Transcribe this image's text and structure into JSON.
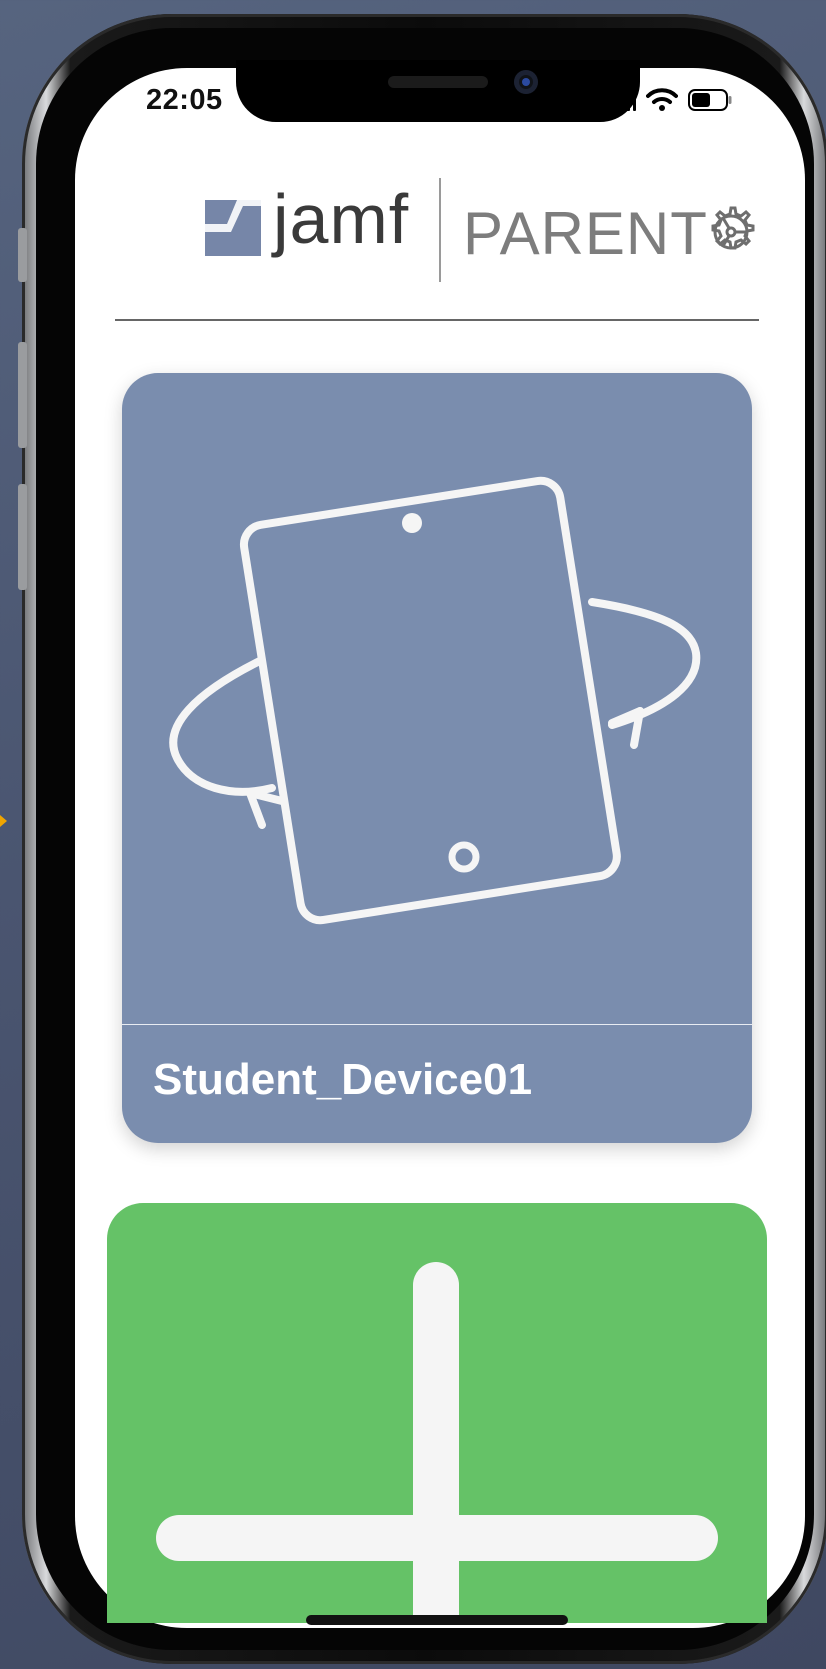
{
  "status_bar": {
    "time": "22:05",
    "icons": [
      "cellular-signal-icon",
      "wifi-icon",
      "battery-icon"
    ]
  },
  "header": {
    "logo_word": "jamf",
    "app_label": "PARENT",
    "settings_icon": "gear-icon"
  },
  "devices": [
    {
      "name": "Student_Device01",
      "icon": "rotating-tablet-icon",
      "card_color": "#7a8dae"
    }
  ],
  "add_device": {
    "icon": "plus-icon",
    "card_color": "#65c267"
  },
  "colors": {
    "brand_slate": "#7a8dae",
    "add_green": "#65c267"
  }
}
